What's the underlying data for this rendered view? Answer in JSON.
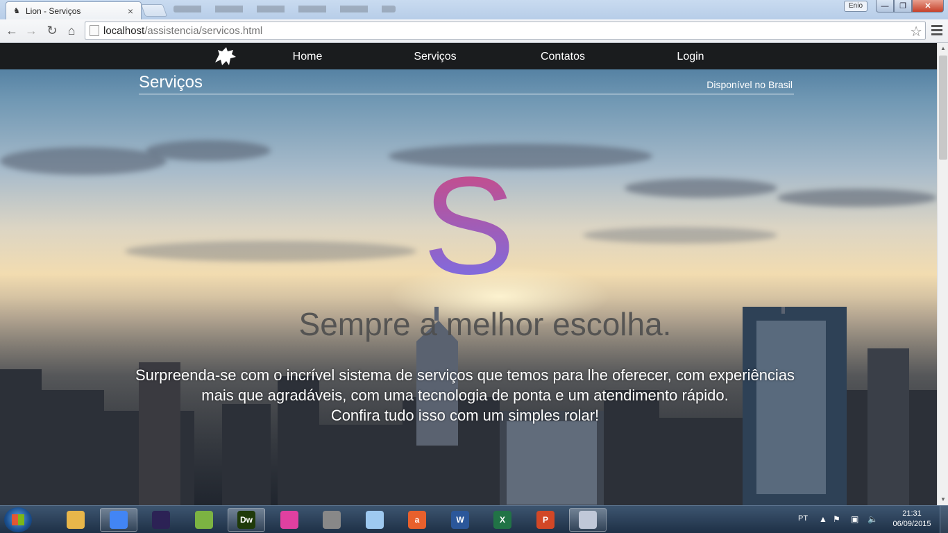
{
  "browser": {
    "tab_title": "Lion - Serviços",
    "tab_close": "×",
    "user_badge": "Enio",
    "url_host": "localhost",
    "url_path": "/assistencia/servicos.html",
    "win_min": "—",
    "win_max": "❐",
    "win_close": "✕"
  },
  "site": {
    "nav": [
      "Home",
      "Serviços",
      "Contatos",
      "Login"
    ],
    "section_title": "Serviços",
    "section_subtitle": "Disponível no Brasil",
    "hero_letter": "S",
    "tagline": "Sempre a melhor escolha.",
    "description": [
      "Surpreenda-se com o incrível sistema de serviços que temos para lhe oferecer, com experiências",
      "mais que agradáveis, com uma tecnologia de ponta e um atendimento rápido.",
      "Confira tudo isso com um simples rolar!"
    ]
  },
  "taskbar": {
    "apps": [
      {
        "name": "file-explorer",
        "label": "",
        "color": "#e8b64a"
      },
      {
        "name": "chrome",
        "label": "",
        "color": "#4285f4"
      },
      {
        "name": "eclipse",
        "label": "",
        "color": "#2c2255"
      },
      {
        "name": "android-studio",
        "label": "",
        "color": "#7cb342"
      },
      {
        "name": "dreamweaver",
        "label": "Dw",
        "color": "#1f3a0a"
      },
      {
        "name": "uml-tool",
        "label": "",
        "color": "#e040a0"
      },
      {
        "name": "tools",
        "label": "",
        "color": "#888888"
      },
      {
        "name": "virtualbox",
        "label": "",
        "color": "#9ec9f0"
      },
      {
        "name": "astah",
        "label": "a",
        "color": "#e8602c"
      },
      {
        "name": "word",
        "label": "W",
        "color": "#2b579a"
      },
      {
        "name": "excel",
        "label": "X",
        "color": "#217346"
      },
      {
        "name": "powerpoint",
        "label": "P",
        "color": "#d24726"
      },
      {
        "name": "paint",
        "label": "",
        "color": "#c0c8d8"
      }
    ],
    "language": "PT",
    "time": "21:31",
    "date": "06/09/2015"
  },
  "colors": {
    "navbar": "#1a1c1e",
    "s_gradient_top": "#d3477a",
    "s_gradient_bottom": "#6f72f2"
  }
}
